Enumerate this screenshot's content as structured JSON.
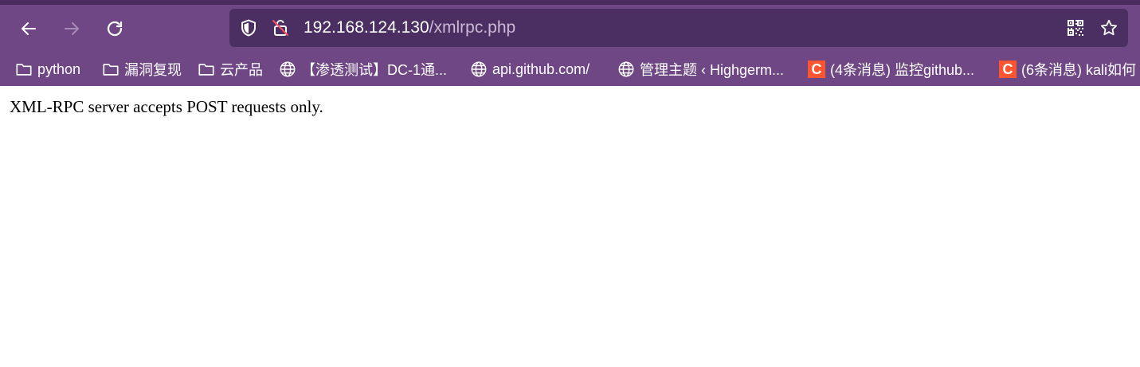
{
  "browser": {
    "nav": {
      "back_icon": "arrow-left-icon",
      "forward_icon": "arrow-right-icon",
      "reload_icon": "reload-icon"
    },
    "urlbar": {
      "host": "192.168.124.130",
      "path": "/xmlrpc.php",
      "shield_icon": "shield-icon",
      "insecure_icon": "insecure-lock-icon",
      "qr_icon": "qr-code-icon",
      "star_icon": "star-icon"
    },
    "bookmarks": [
      {
        "label": "python",
        "icon": "folder-icon"
      },
      {
        "label": "漏洞复现",
        "icon": "folder-icon"
      },
      {
        "label": "云产品",
        "icon": "folder-icon"
      },
      {
        "label": "【渗透测试】DC-1通...",
        "icon": "globe-icon"
      },
      {
        "label": "api.github.com/",
        "icon": "globe-icon"
      },
      {
        "label": "管理主题 ‹ Highgerm...",
        "icon": "globe-icon"
      },
      {
        "label": "(4条消息) 监控github...",
        "icon": "csdn-icon",
        "icon_text": "C"
      },
      {
        "label": "(6条消息) kali如何",
        "icon": "csdn-icon",
        "icon_text": "C"
      }
    ]
  },
  "page": {
    "message": "XML-RPC server accepts POST requests only."
  },
  "colors": {
    "chrome_bg": "#6f4785",
    "urlbar_bg": "#4b2f62",
    "csdn_brand": "#fc5531"
  }
}
